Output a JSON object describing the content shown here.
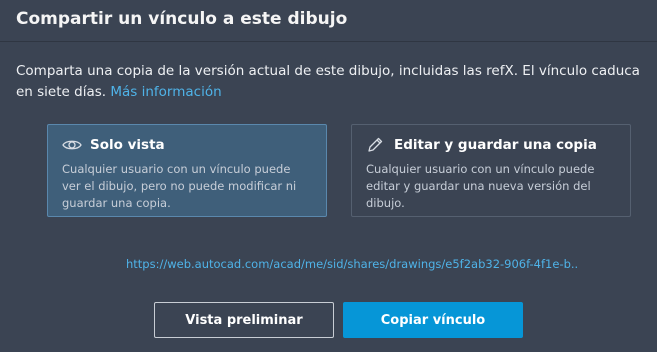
{
  "dialog": {
    "title": "Compartir un vínculo a este dibujo",
    "description": "Comparta una copia de la versión actual de este dibujo, incluidas las refX. El vínculo caduca en siete días.",
    "more_info_link": "Más información",
    "options": [
      {
        "title": "Solo vista",
        "icon": "eye-icon",
        "text": "Cualquier usuario con un vínculo puede ver el dibujo, pero no puede modificar ni guardar una copia.",
        "selected": true
      },
      {
        "title": "Editar y guardar una copia",
        "icon": "pencil-icon",
        "text": "Cualquier usuario con un vínculo puede editar y guardar una nueva versión del dibujo.",
        "selected": false
      }
    ],
    "share_url": "https://web.autocad.com/acad/me/sid/shares/drawings/e5f2ab32-906f-4f1e-b...",
    "preview_button": "Vista preliminar",
    "copy_button": "Copiar vínculo"
  },
  "colors": {
    "background": "#3b4453",
    "selected_card": "#3f5f7a",
    "link": "#4fb3e8",
    "primary_button": "#0696d7"
  }
}
